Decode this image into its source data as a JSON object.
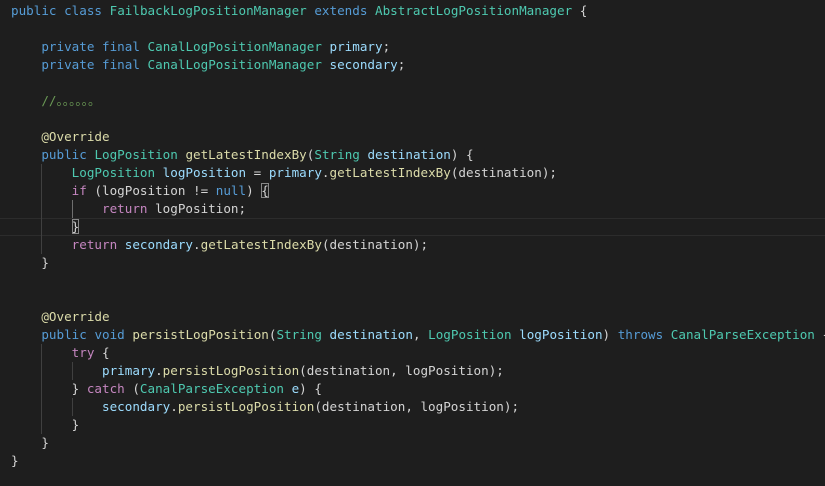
{
  "editor": {
    "theme": {
      "background": "#1e1e1e",
      "keyword": "#569cd6",
      "control": "#c586c0",
      "type": "#4ec9b0",
      "function": "#dcdcaa",
      "variable": "#9cdcfe",
      "comment": "#6a9955",
      "text": "#d4d4d4"
    },
    "current_line": 12,
    "lines": [
      {
        "tokens": [
          {
            "t": "public",
            "c": "kw"
          },
          {
            "t": " "
          },
          {
            "t": "class",
            "c": "kw"
          },
          {
            "t": " "
          },
          {
            "t": "FailbackLogPositionManager",
            "c": "type"
          },
          {
            "t": " "
          },
          {
            "t": "extends",
            "c": "kw"
          },
          {
            "t": " "
          },
          {
            "t": "AbstractLogPositionManager",
            "c": "type"
          },
          {
            "t": " {"
          }
        ]
      },
      {
        "tokens": []
      },
      {
        "tokens": [
          {
            "t": "    "
          },
          {
            "t": "private",
            "c": "kw"
          },
          {
            "t": " "
          },
          {
            "t": "final",
            "c": "kw"
          },
          {
            "t": " "
          },
          {
            "t": "CanalLogPositionManager",
            "c": "type"
          },
          {
            "t": " "
          },
          {
            "t": "primary",
            "c": "var"
          },
          {
            "t": ";"
          }
        ]
      },
      {
        "tokens": [
          {
            "t": "    "
          },
          {
            "t": "private",
            "c": "kw"
          },
          {
            "t": " "
          },
          {
            "t": "final",
            "c": "kw"
          },
          {
            "t": " "
          },
          {
            "t": "CanalLogPositionManager",
            "c": "type"
          },
          {
            "t": " "
          },
          {
            "t": "secondary",
            "c": "var"
          },
          {
            "t": ";"
          }
        ]
      },
      {
        "tokens": []
      },
      {
        "tokens": [
          {
            "t": "    "
          },
          {
            "t": "//。。。。。。",
            "c": "cmt"
          }
        ]
      },
      {
        "tokens": []
      },
      {
        "tokens": [
          {
            "t": "    "
          },
          {
            "t": "@Override",
            "c": "anno"
          }
        ]
      },
      {
        "tokens": [
          {
            "t": "    "
          },
          {
            "t": "public",
            "c": "kw"
          },
          {
            "t": " "
          },
          {
            "t": "LogPosition",
            "c": "type"
          },
          {
            "t": " "
          },
          {
            "t": "getLatestIndexBy",
            "c": "fn"
          },
          {
            "t": "("
          },
          {
            "t": "String",
            "c": "type"
          },
          {
            "t": " "
          },
          {
            "t": "destination",
            "c": "var"
          },
          {
            "t": ") {"
          }
        ]
      },
      {
        "tokens": [
          {
            "t": "        "
          },
          {
            "t": "LogPosition",
            "c": "type"
          },
          {
            "t": " "
          },
          {
            "t": "logPosition",
            "c": "var"
          },
          {
            "t": " = "
          },
          {
            "t": "primary",
            "c": "var"
          },
          {
            "t": "."
          },
          {
            "t": "getLatestIndexBy",
            "c": "fn"
          },
          {
            "t": "(destination);"
          }
        ]
      },
      {
        "tokens": [
          {
            "t": "        "
          },
          {
            "t": "if",
            "c": "ctl"
          },
          {
            "t": " (logPosition != "
          },
          {
            "t": "null",
            "c": "kw"
          },
          {
            "t": ") "
          },
          {
            "t": "{",
            "m": true
          }
        ]
      },
      {
        "tokens": [
          {
            "t": "            "
          },
          {
            "t": "return",
            "c": "ctl"
          },
          {
            "t": " logPosition;"
          }
        ]
      },
      {
        "tokens": [
          {
            "t": "        "
          },
          {
            "t": "}",
            "m": true
          }
        ]
      },
      {
        "tokens": [
          {
            "t": "        "
          },
          {
            "t": "return",
            "c": "ctl"
          },
          {
            "t": " "
          },
          {
            "t": "secondary",
            "c": "var"
          },
          {
            "t": "."
          },
          {
            "t": "getLatestIndexBy",
            "c": "fn"
          },
          {
            "t": "(destination);"
          }
        ]
      },
      {
        "tokens": [
          {
            "t": "    }"
          }
        ]
      },
      {
        "tokens": []
      },
      {
        "tokens": []
      },
      {
        "tokens": [
          {
            "t": "    "
          },
          {
            "t": "@Override",
            "c": "anno"
          }
        ]
      },
      {
        "tokens": [
          {
            "t": "    "
          },
          {
            "t": "public",
            "c": "kw"
          },
          {
            "t": " "
          },
          {
            "t": "void",
            "c": "kw"
          },
          {
            "t": " "
          },
          {
            "t": "persistLogPosition",
            "c": "fn"
          },
          {
            "t": "("
          },
          {
            "t": "String",
            "c": "type"
          },
          {
            "t": " "
          },
          {
            "t": "destination",
            "c": "var"
          },
          {
            "t": ", "
          },
          {
            "t": "LogPosition",
            "c": "type"
          },
          {
            "t": " "
          },
          {
            "t": "logPosition",
            "c": "var"
          },
          {
            "t": ") "
          },
          {
            "t": "throws",
            "c": "kw"
          },
          {
            "t": " "
          },
          {
            "t": "CanalParseException",
            "c": "type"
          },
          {
            "t": " {"
          }
        ]
      },
      {
        "tokens": [
          {
            "t": "        "
          },
          {
            "t": "try",
            "c": "ctl"
          },
          {
            "t": " {"
          }
        ]
      },
      {
        "tokens": [
          {
            "t": "            "
          },
          {
            "t": "primary",
            "c": "var"
          },
          {
            "t": "."
          },
          {
            "t": "persistLogPosition",
            "c": "fn"
          },
          {
            "t": "(destination, logPosition);"
          }
        ]
      },
      {
        "tokens": [
          {
            "t": "        } "
          },
          {
            "t": "catch",
            "c": "ctl"
          },
          {
            "t": " ("
          },
          {
            "t": "CanalParseException",
            "c": "type"
          },
          {
            "t": " "
          },
          {
            "t": "e",
            "c": "var"
          },
          {
            "t": ") {"
          }
        ]
      },
      {
        "tokens": [
          {
            "t": "            "
          },
          {
            "t": "secondary",
            "c": "var"
          },
          {
            "t": "."
          },
          {
            "t": "persistLogPosition",
            "c": "fn"
          },
          {
            "t": "(destination, logPosition);"
          }
        ]
      },
      {
        "tokens": [
          {
            "t": "        }"
          }
        ]
      },
      {
        "tokens": [
          {
            "t": "    }"
          }
        ]
      },
      {
        "tokens": [
          {
            "t": "}"
          }
        ]
      }
    ]
  }
}
